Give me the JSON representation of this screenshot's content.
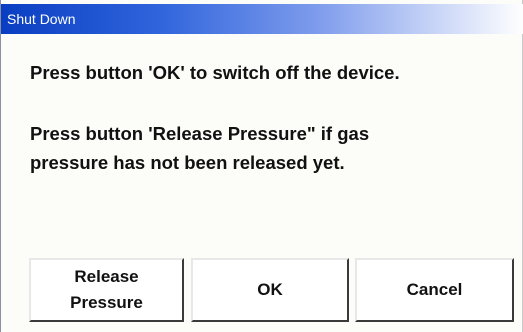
{
  "window": {
    "title": "Shut Down"
  },
  "messages": {
    "line1": "Press button 'OK' to switch off the device.",
    "line2a": "Press button 'Release Pressure\" if gas",
    "line2b": "pressure has not been released yet."
  },
  "buttons": {
    "release_label": "Release\nPressure",
    "ok_label": "OK",
    "cancel_label": "Cancel"
  },
  "colors": {
    "titlebar_accent": "#0a3ec2",
    "title_text": "#ffffff",
    "background": "#fcfcf9"
  }
}
